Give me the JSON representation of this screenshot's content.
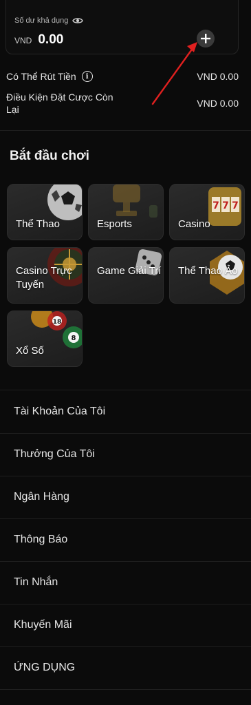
{
  "balance": {
    "label": "Số dư khả dụng",
    "currency": "VND",
    "amount": "0.00"
  },
  "withdrawable": {
    "label": "Có Thể Rút Tiền",
    "value": "VND 0.00"
  },
  "betting_condition": {
    "label": "Điều Kiện Đặt Cược Còn Lại",
    "value": "VND 0.00"
  },
  "games": {
    "title": "Bắt đầu chơi",
    "tiles": [
      {
        "label": "Thể Thao",
        "icon": "soccer-ball-icon"
      },
      {
        "label": "Esports",
        "icon": "trophy-icon"
      },
      {
        "label": "Casino",
        "icon": "slot-machine-icon"
      },
      {
        "label": "Casino Trực Tuyến",
        "icon": "roulette-icon"
      },
      {
        "label": "Game Giải Trí",
        "icon": "dice-icon"
      },
      {
        "label": "Thể Thao Ảo",
        "icon": "virtual-soccer-icon"
      },
      {
        "label": "Xổ Số",
        "icon": "lottery-balls-icon"
      }
    ]
  },
  "menu": {
    "items": [
      {
        "label": "Tài Khoản Của Tôi"
      },
      {
        "label": "Thưởng Của Tôi"
      },
      {
        "label": "Ngân Hàng"
      },
      {
        "label": "Thông Báo"
      },
      {
        "label": "Tin Nhắn"
      },
      {
        "label": "Khuyến Mãi"
      },
      {
        "label": "ỨNG DỤNG"
      }
    ]
  },
  "colors": {
    "background": "#0b0b0b",
    "card": "#1f1f1f",
    "accent_arrow": "#e0201f"
  }
}
